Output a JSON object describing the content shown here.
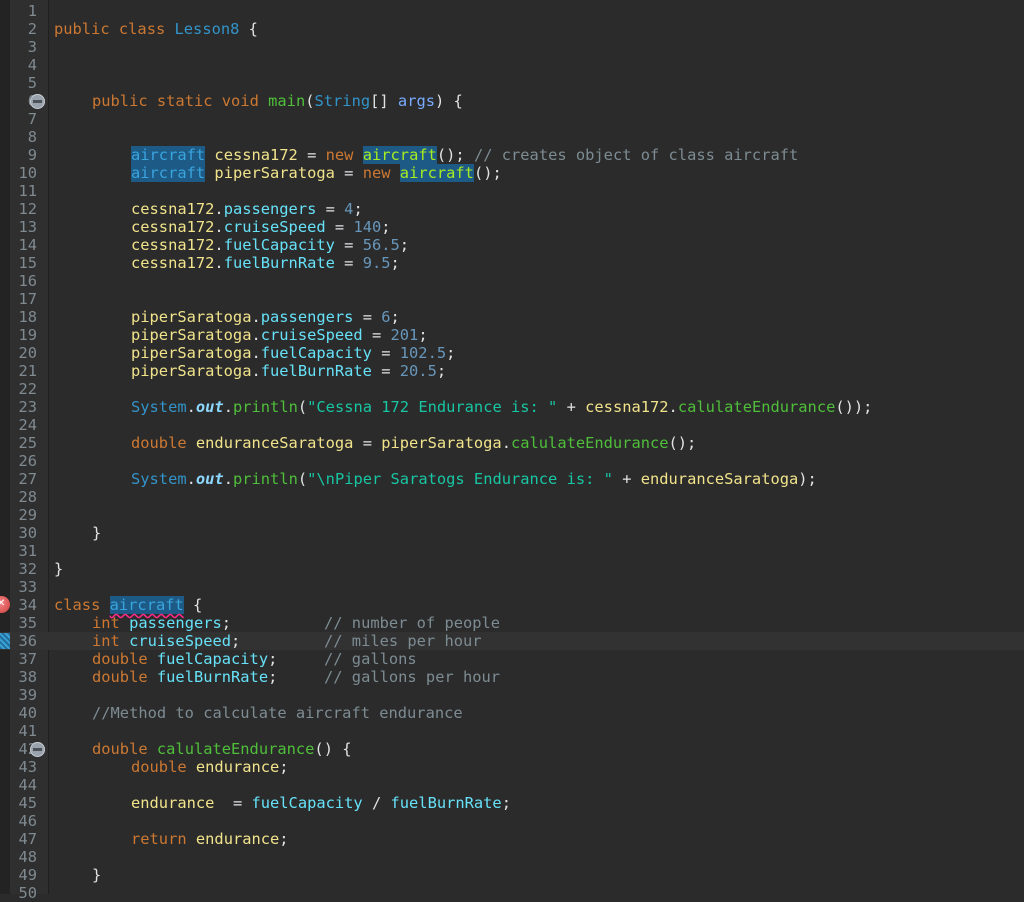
{
  "editor": {
    "language": "java",
    "line_numbers": [
      "1",
      "2",
      "3",
      "4",
      "5",
      "6",
      "7",
      "8",
      "9",
      "10",
      "11",
      "12",
      "13",
      "14",
      "15",
      "16",
      "17",
      "18",
      "19",
      "20",
      "21",
      "22",
      "23",
      "24",
      "25",
      "26",
      "27",
      "28",
      "29",
      "30",
      "31",
      "32",
      "33",
      "34",
      "35",
      "36",
      "37",
      "38",
      "39",
      "40",
      "41",
      "42",
      "43",
      "44",
      "45",
      "46",
      "47",
      "48",
      "49",
      "50"
    ],
    "current_line": "36",
    "folded_lines": [
      "6",
      "42"
    ],
    "error_line": "34",
    "lines": {
      "l2": [
        "public",
        " ",
        "class",
        " ",
        "Lesson8",
        " {"
      ],
      "l6": [
        "public",
        " ",
        "static",
        " ",
        "void",
        " ",
        "main",
        "(",
        "String",
        "[] ",
        "args",
        ") {"
      ],
      "l9": [
        "aircraft",
        " ",
        "cessna172",
        " = ",
        "new",
        " ",
        "aircraft",
        "(); ",
        "// creates object of class aircraft"
      ],
      "l10": [
        "aircraft",
        " ",
        "piperSaratoga",
        " = ",
        "new",
        " ",
        "aircraft",
        "();"
      ],
      "l12": [
        "cessna172",
        ".",
        "passengers",
        " = ",
        "4",
        ";"
      ],
      "l13": [
        "cessna172",
        ".",
        "cruiseSpeed",
        " = ",
        "140",
        ";"
      ],
      "l14": [
        "cessna172",
        ".",
        "fuelCapacity",
        " = ",
        "56.5",
        ";"
      ],
      "l15": [
        "cessna172",
        ".",
        "fuelBurnRate",
        " = ",
        "9.5",
        ";"
      ],
      "l18": [
        "piperSaratoga",
        ".",
        "passengers",
        " = ",
        "6",
        ";"
      ],
      "l19": [
        "piperSaratoga",
        ".",
        "cruiseSpeed",
        " = ",
        "201",
        ";"
      ],
      "l20": [
        "piperSaratoga",
        ".",
        "fuelCapacity",
        " = ",
        "102.5",
        ";"
      ],
      "l21": [
        "piperSaratoga",
        ".",
        "fuelBurnRate",
        " = ",
        "20.5",
        ";"
      ],
      "l23": [
        "System",
        ".",
        "out",
        ".",
        "println",
        "(",
        "\"Cessna 172 Endurance is: \"",
        " + ",
        "cessna172",
        ".",
        "calulateEndurance",
        "());"
      ],
      "l25": [
        "double",
        " ",
        "enduranceSaratoga",
        " = ",
        "piperSaratoga",
        ".",
        "calulateEndurance",
        "();"
      ],
      "l27": [
        "System",
        ".",
        "out",
        ".",
        "println",
        "(",
        "\"\\nPiper Saratogs Endurance is: \"",
        " + ",
        "enduranceSaratoga",
        ");"
      ],
      "l30": [
        "}"
      ],
      "l32": [
        "}"
      ],
      "l34": [
        "class",
        " ",
        "aircraft",
        " {"
      ],
      "l35": [
        "int",
        " ",
        "passengers",
        ";",
        "// number of people"
      ],
      "l36": [
        "int",
        " ",
        "cruiseSpeed",
        ";",
        "// miles per hour"
      ],
      "l37": [
        "double",
        " ",
        "fuelCapacity",
        ";",
        "// gallons"
      ],
      "l38": [
        "double",
        " ",
        "fuelBurnRate",
        ";",
        "// gallons per hour"
      ],
      "l40": [
        "//Method to calculate aircraft endurance"
      ],
      "l42": [
        "double",
        " ",
        "calulateEndurance",
        "() {"
      ],
      "l43": [
        "double",
        " ",
        "endurance",
        ";"
      ],
      "l45": [
        "endurance",
        "  = ",
        "fuelCapacity",
        " / ",
        "fuelBurnRate",
        ";"
      ],
      "l47": [
        "return",
        " ",
        "endurance",
        ";"
      ],
      "l49": [
        "}"
      ]
    }
  },
  "colors": {
    "background": "#2b2b2b",
    "keyword": "#cc7832",
    "class_name": "#3294c9",
    "method": "#4fbf3a",
    "local_variable": "#f1e38b",
    "field": "#66e1f8",
    "number": "#6897bb",
    "comment": "#7d8c93",
    "string": "#17c6a3",
    "occurrence_highlight": "#1d5b86",
    "error_underline": "#ff2b8c"
  }
}
